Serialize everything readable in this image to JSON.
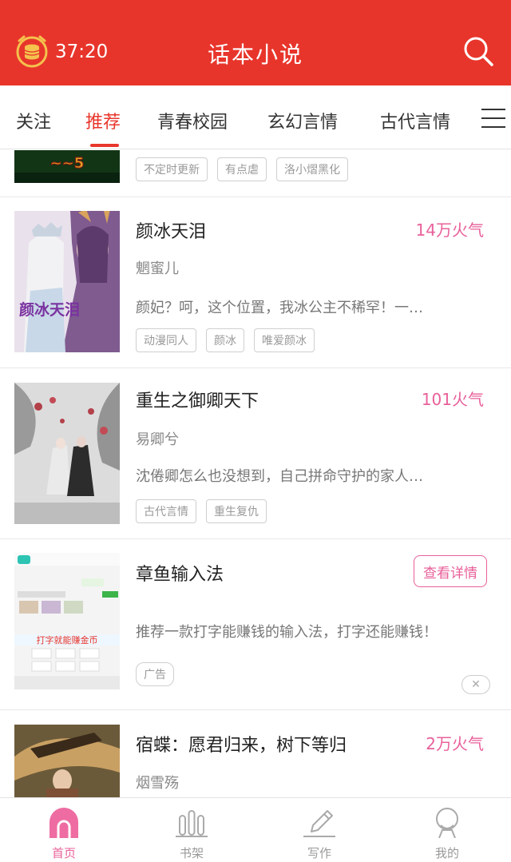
{
  "header": {
    "timer": "37:20",
    "app_title": "话本小说",
    "coin_icon": "coin-stack-alarm-icon",
    "search_icon": "search-icon"
  },
  "tabs": [
    {
      "label": "关注",
      "active": false
    },
    {
      "label": "推荐",
      "active": true
    },
    {
      "label": "青春校园",
      "active": false
    },
    {
      "label": "玄幻言情",
      "active": false
    },
    {
      "label": "古代言情",
      "active": false
    }
  ],
  "tags_partial": [
    "不定时更新",
    "有点虐",
    "洛小熠黑化"
  ],
  "books": [
    {
      "title": "颜冰天泪",
      "heat": "14万火气",
      "author": "魍蜜儿",
      "desc": "颜妃？呵，这个位置，我冰公主不稀罕！一…",
      "tags": [
        "动漫同人",
        "颜冰",
        "唯爱颜冰"
      ],
      "cover_text": "颜冰天泪"
    },
    {
      "title": "重生之御卿天下",
      "heat": "101火气",
      "author": "易卿兮",
      "desc": "沈倦卿怎么也没想到，自己拼命守护的家人…",
      "tags": [
        "古代言情",
        "重生复仇"
      ]
    }
  ],
  "ad": {
    "title": "章鱼输入法",
    "button": "查看详情",
    "desc": "推荐一款打字能赚钱的输入法，打字还能赚钱！",
    "tag": "广告",
    "close": "✕",
    "screen_banner": "打字就能赚金币"
  },
  "book_partial": {
    "title": "宿蝶：愿君归来，树下等归",
    "heat": "2万火气",
    "author": "烟雪殇"
  },
  "tabbar": [
    {
      "label": "首页",
      "icon": "home-icon",
      "active": true
    },
    {
      "label": "书架",
      "icon": "bookshelf-icon",
      "active": false
    },
    {
      "label": "写作",
      "icon": "pen-icon",
      "active": false
    },
    {
      "label": "我的",
      "icon": "profile-icon",
      "active": false
    }
  ],
  "colors": {
    "brand": "#e8352b",
    "accent_pink": "#e8609a"
  }
}
